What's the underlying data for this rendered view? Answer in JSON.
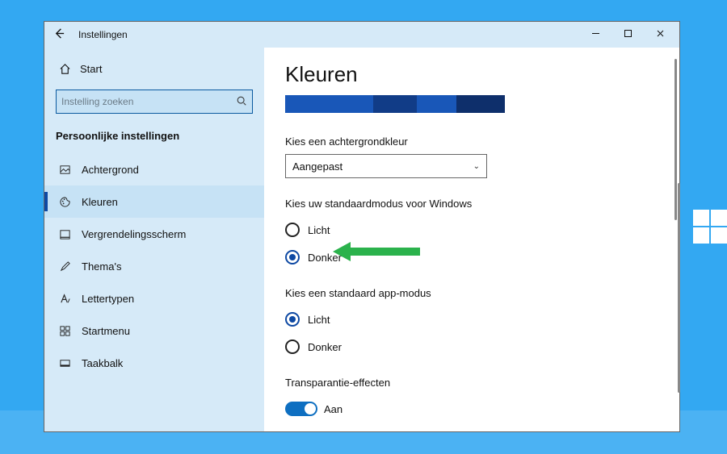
{
  "window": {
    "title": "Instellingen"
  },
  "sidebar": {
    "home_label": "Start",
    "search_placeholder": "Instelling zoeken",
    "section_title": "Persoonlijke instellingen",
    "items": [
      {
        "label": "Achtergrond",
        "icon": "picture"
      },
      {
        "label": "Kleuren",
        "icon": "palette",
        "active": true
      },
      {
        "label": "Vergrendelingsscherm",
        "icon": "lockscreen"
      },
      {
        "label": "Thema's",
        "icon": "brush"
      },
      {
        "label": "Lettertypen",
        "icon": "font"
      },
      {
        "label": "Startmenu",
        "icon": "startmenu"
      },
      {
        "label": "Taakbalk",
        "icon": "taskbar"
      }
    ]
  },
  "content": {
    "title": "Kleuren",
    "bg_label": "Kies een achtergrondkleur",
    "bg_select_value": "Aangepast",
    "win_mode_label": "Kies uw standaardmodus voor Windows",
    "win_mode_options": {
      "light": "Licht",
      "dark": "Donker"
    },
    "win_mode_selected": "dark",
    "app_mode_label": "Kies een standaard app-modus",
    "app_mode_options": {
      "light": "Licht",
      "dark": "Donker"
    },
    "app_mode_selected": "light",
    "transparency_label": "Transparantie-effecten",
    "transparency_value": "Aan"
  },
  "colors": {
    "accent": "#0e49a3",
    "desktop": "#33a8f2",
    "sidebar": "#d6eaf8"
  }
}
